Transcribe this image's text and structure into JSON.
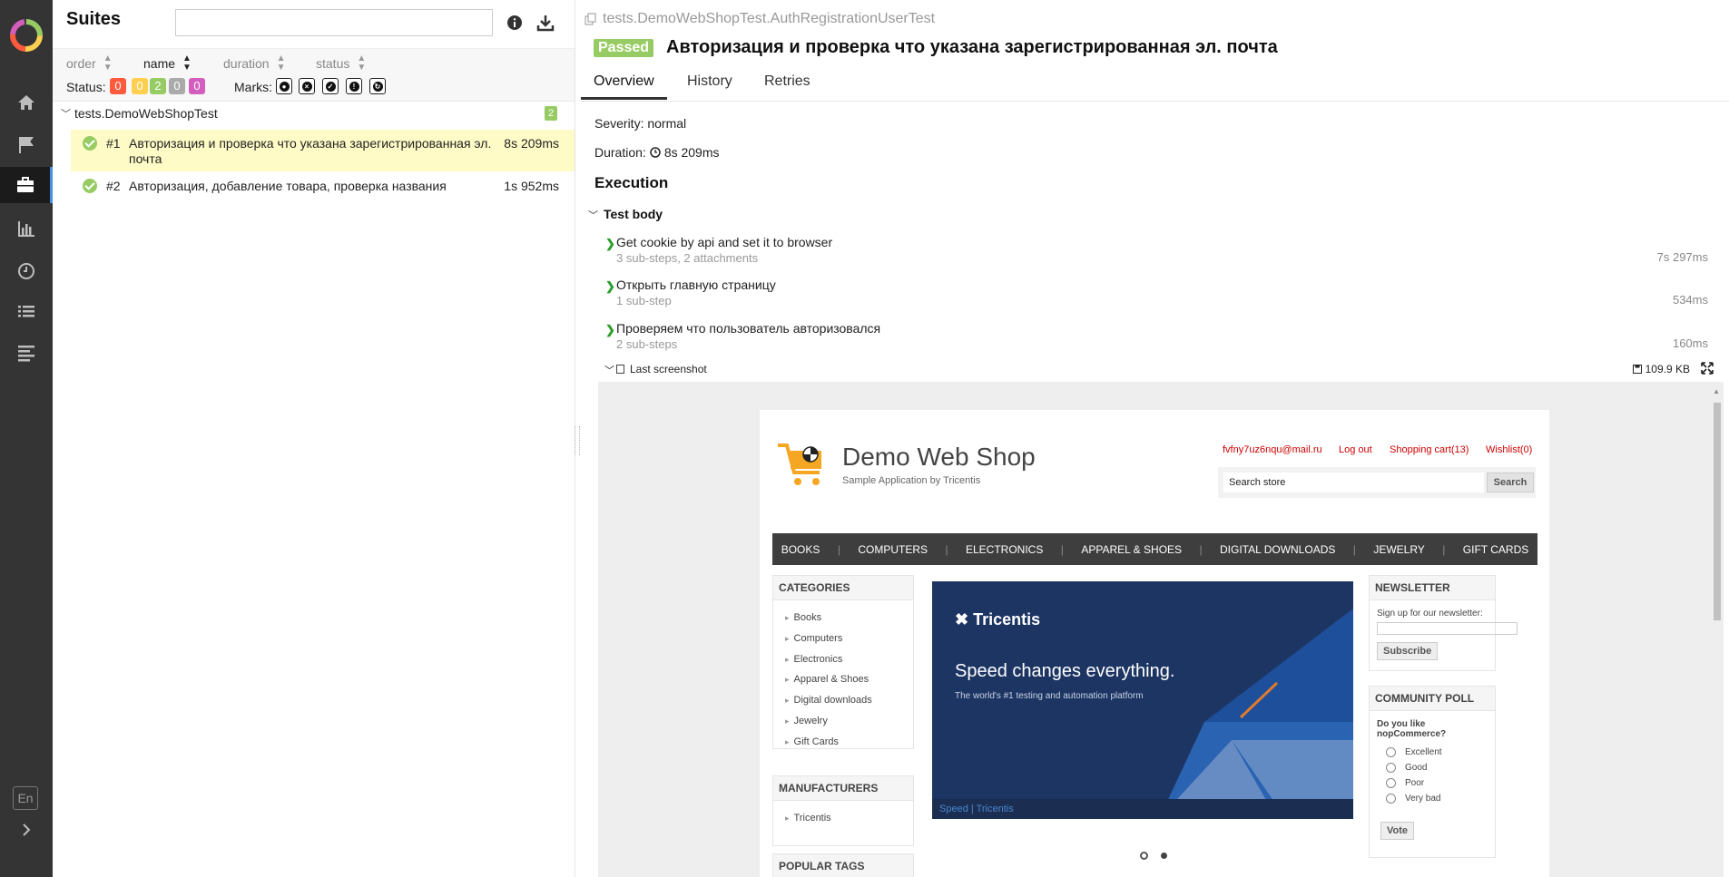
{
  "nav": {
    "items": [
      "home-icon",
      "flag-icon",
      "briefcase-icon",
      "chart-icon",
      "clock-icon",
      "list-icon",
      "align-icon"
    ],
    "lang": "En"
  },
  "suites": {
    "title": "Suites",
    "search_value": "",
    "sort": [
      "order",
      "name",
      "duration",
      "status"
    ],
    "status_label": "Status:",
    "status_counts": [
      {
        "value": "0",
        "color": "#fd5a3e"
      },
      {
        "value": "0",
        "color": "#ffd050"
      },
      {
        "value": "2",
        "color": "#97cc64"
      },
      {
        "value": "0",
        "color": "#aaaaaa"
      },
      {
        "value": "0",
        "color": "#d35ebe"
      }
    ],
    "marks_label": "Marks:",
    "group_name": "tests.DemoWebShopTest",
    "group_count": "2",
    "tests": [
      {
        "num": "#1",
        "title": "Авторизация и проверка что указана зарегистрированная эл. почта",
        "duration": "8s 209ms"
      },
      {
        "num": "#2",
        "title": "Авторизация, добавление товара, проверка названия",
        "duration": "1s 952ms"
      }
    ]
  },
  "result": {
    "path": "tests.DemoWebShopTest.AuthRegistrationUserTest",
    "status": "Passed",
    "title": "Авторизация и проверка что указана зарегистрированная эл. почта",
    "tabs": [
      "Overview",
      "History",
      "Retries"
    ],
    "severity": "Severity: normal",
    "duration_label": "Duration:",
    "duration": "8s 209ms",
    "execution": "Execution",
    "test_body": "Test body",
    "steps": [
      {
        "name": "Get cookie by api and set it to browser",
        "sub": "3 sub-steps, 2 attachments",
        "duration": "7s 297ms"
      },
      {
        "name": "Открыть главную страницу",
        "sub": "1 sub-step",
        "duration": "534ms"
      },
      {
        "name": "Проверяем что пользователь авторизовался",
        "sub": "2 sub-steps",
        "duration": "160ms"
      }
    ],
    "attachment": {
      "name": "Last screenshot",
      "size": "109.9 KB"
    }
  },
  "shop": {
    "name": "Demo Web Shop",
    "subtitle": "Sample Application by Tricentis",
    "links": [
      "fvfny7uz6nqu@mail.ru",
      "Log out",
      "Shopping cart(13)",
      "Wishlist(0)"
    ],
    "search_value": "Search store",
    "search_button": "Search",
    "menu": [
      "BOOKS",
      "COMPUTERS",
      "ELECTRONICS",
      "APPAREL & SHOES",
      "DIGITAL DOWNLOADS",
      "JEWELRY",
      "GIFT CARDS"
    ],
    "categories_title": "CATEGORIES",
    "categories": [
      "Books",
      "Computers",
      "Electronics",
      "Apparel & Shoes",
      "Digital downloads",
      "Jewelry",
      "Gift Cards"
    ],
    "manufacturers_title": "MANUFACTURERS",
    "manufacturers": [
      "Tricentis"
    ],
    "popular_tags_title": "POPULAR TAGS",
    "slider": {
      "brand": "Tricentis",
      "headline": "Speed changes everything.",
      "tagline": "The world's #1 testing and automation platform",
      "caption": "Speed | Tricentis"
    },
    "newsletter_title": "NEWSLETTER",
    "newsletter_label": "Sign up for our newsletter:",
    "subscribe": "Subscribe",
    "poll_title": "COMMUNITY POLL",
    "poll_question": "Do you like nopCommerce?",
    "poll_options": [
      "Excellent",
      "Good",
      "Poor",
      "Very bad"
    ],
    "vote": "Vote"
  }
}
